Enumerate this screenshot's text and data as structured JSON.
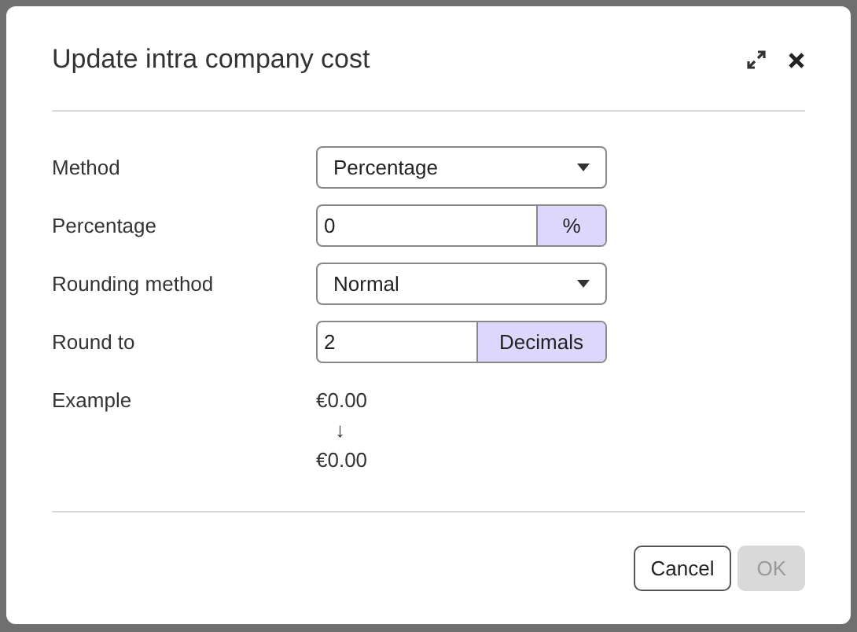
{
  "dialog": {
    "title": "Update intra company cost",
    "fields": [
      {
        "kind": "select",
        "label": "Method",
        "value": "Percentage"
      },
      {
        "kind": "addon",
        "label": "Percentage",
        "value": "0",
        "addon": "%"
      },
      {
        "kind": "select",
        "label": "Rounding method",
        "value": "Normal"
      },
      {
        "kind": "addon",
        "label": "Round to",
        "value": "2",
        "addon": "Decimals"
      },
      {
        "kind": "example",
        "label": "Example",
        "from": "€0.00",
        "arrow": "↓",
        "to": "€0.00"
      }
    ],
    "buttons": [
      {
        "label": "Cancel",
        "disabled": false
      },
      {
        "label": "OK",
        "disabled": true
      }
    ]
  }
}
